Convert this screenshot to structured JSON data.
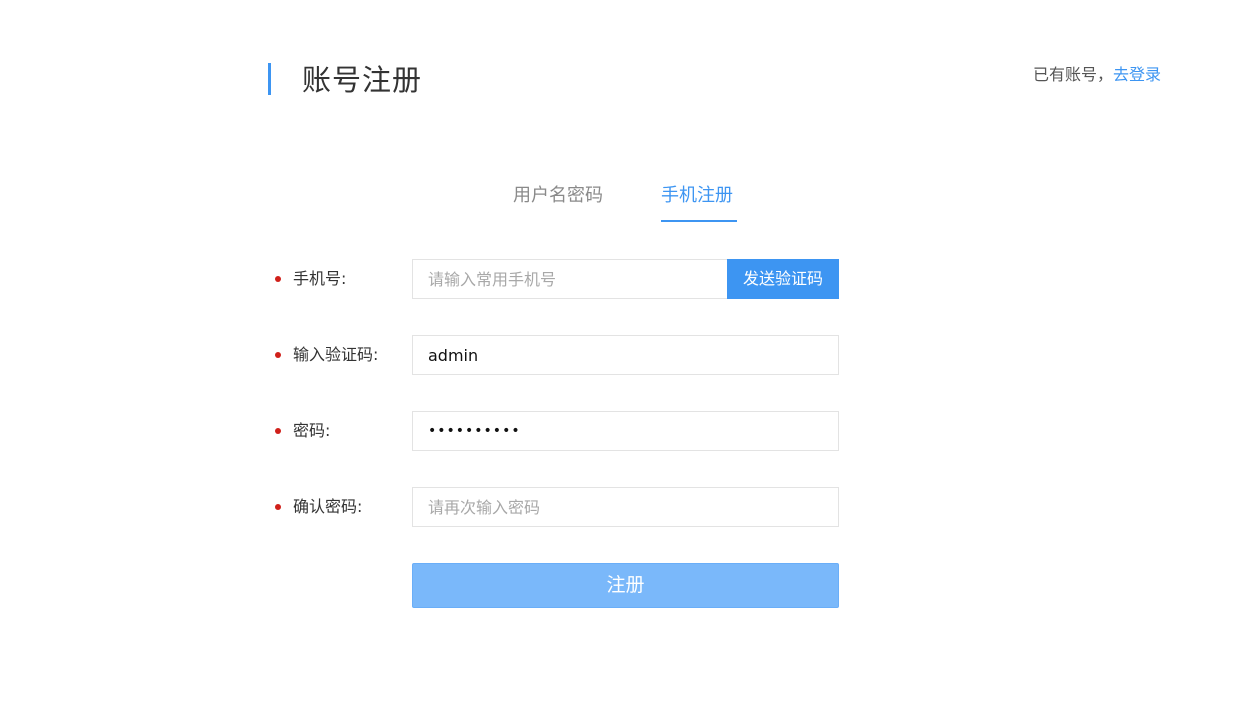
{
  "header": {
    "title": "账号注册",
    "login_prompt": "已有账号，",
    "login_link": "去登录"
  },
  "tabs": [
    {
      "label": "用户名密码",
      "active": false
    },
    {
      "label": "手机注册",
      "active": true
    }
  ],
  "form": {
    "phone": {
      "label": "手机号:",
      "value": "",
      "placeholder": "请输入常用手机号",
      "send_code_label": "发送验证码"
    },
    "code": {
      "label": "输入验证码:",
      "value": "admin",
      "placeholder": ""
    },
    "password": {
      "label": "密码:",
      "value": "••••••••••",
      "placeholder": ""
    },
    "confirm_password": {
      "label": "确认密码:",
      "value": "",
      "placeholder": "请再次输入密码"
    },
    "submit_label": "注册"
  },
  "colors": {
    "accent": "#3d95f2",
    "submit_bg": "#7ab8fa",
    "required_dot": "#d0201a"
  }
}
